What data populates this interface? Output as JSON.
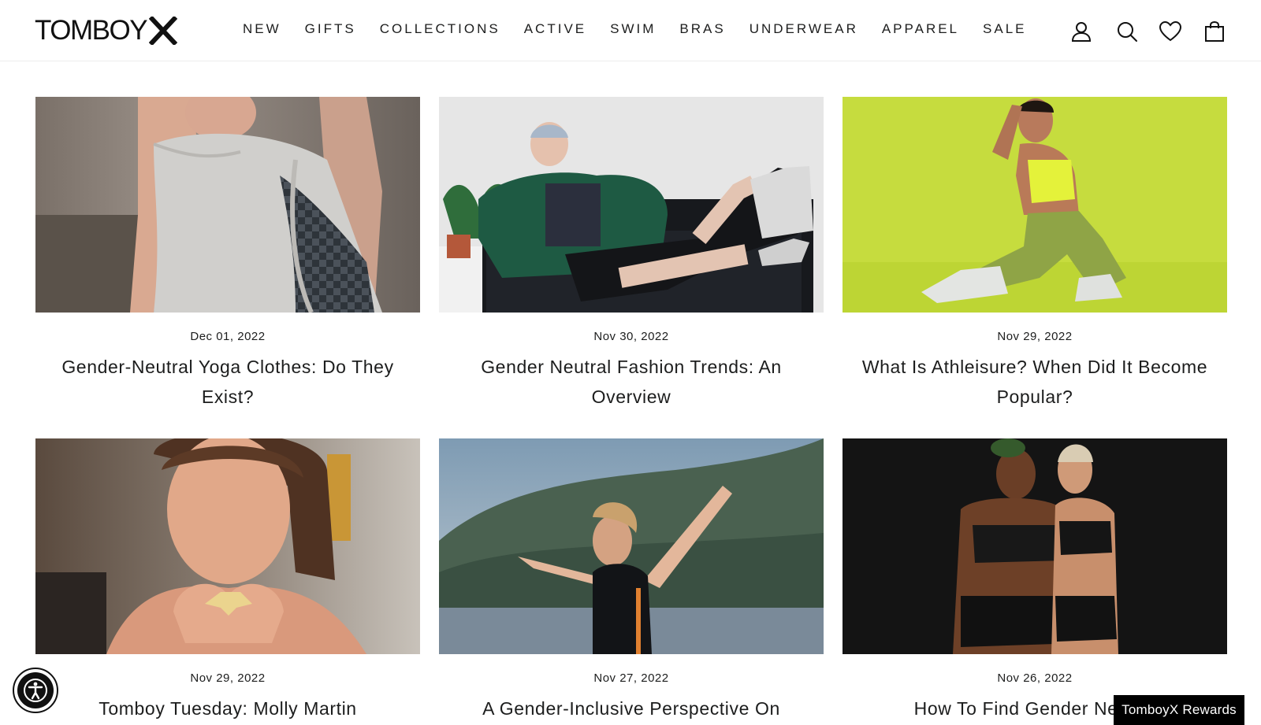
{
  "brand": {
    "logo_text": "TOMBOY",
    "logo_mark": "X"
  },
  "nav": {
    "items": [
      "NEW",
      "GIFTS",
      "COLLECTIONS",
      "ACTIVE",
      "SWIM",
      "BRAS",
      "UNDERWEAR",
      "APPAREL",
      "SALE"
    ]
  },
  "header_icons": [
    "account-icon",
    "search-icon",
    "wishlist-heart-icon",
    "cart-bag-icon"
  ],
  "articles": [
    {
      "date": "Dec 01, 2022",
      "title": "Gender-Neutral Yoga Clothes: Do They Exist?"
    },
    {
      "date": "Nov 30, 2022",
      "title": "Gender Neutral Fashion Trends: An Overview"
    },
    {
      "date": "Nov 29, 2022",
      "title": "What Is Athleisure? When Did It Become Popular?"
    },
    {
      "date": "Nov 29, 2022",
      "title": "Tomboy Tuesday: Molly Martin"
    },
    {
      "date": "Nov 27, 2022",
      "title": "A Gender-Inclusive Perspective On"
    },
    {
      "date": "Nov 26, 2022",
      "title": "How To Find Gender Neutral"
    }
  ],
  "accessibility_button": {
    "icon": "accessibility-icon"
  },
  "rewards_button": {
    "label": "TomboyX Rewards"
  },
  "colors": {
    "text": "#1c1d1d",
    "background": "#ffffff",
    "rewards_bg": "#000000",
    "athleisure_bg": "#c6dc3e"
  }
}
